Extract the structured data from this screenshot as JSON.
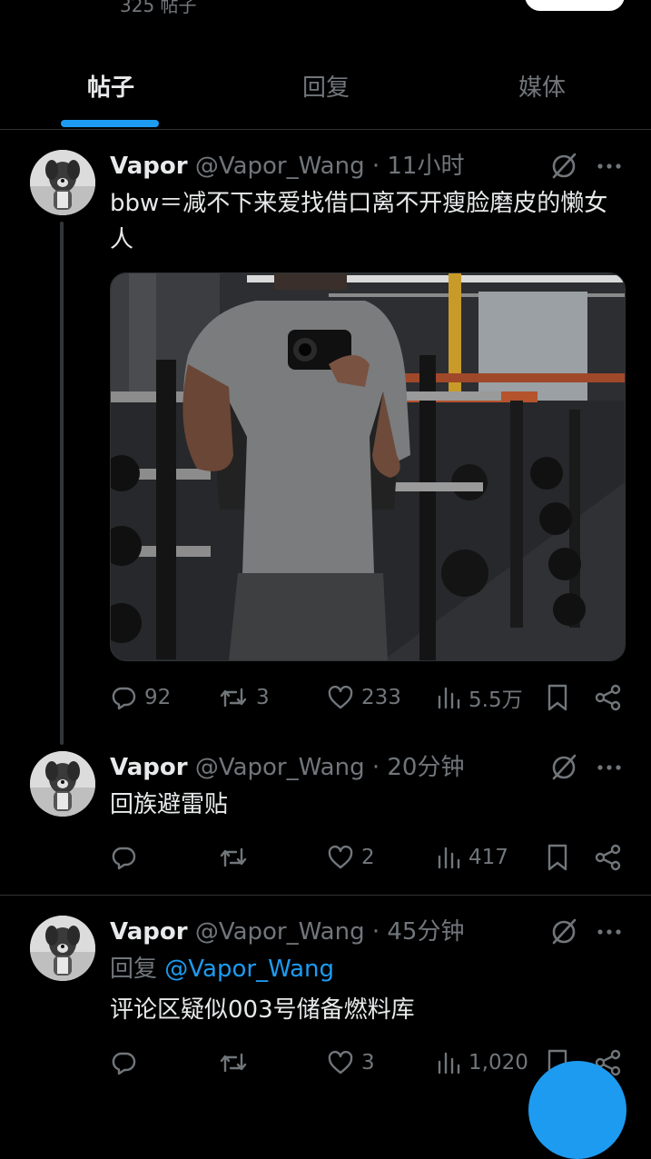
{
  "profile": {
    "post_count": "325 帖子"
  },
  "tabs": [
    {
      "label": "帖子",
      "active": true
    },
    {
      "label": "回复",
      "active": false
    },
    {
      "label": "媒体",
      "active": false
    }
  ],
  "colors": {
    "background": "#000000",
    "text_primary": "#e7e9ea",
    "text_secondary": "#71767b",
    "accent": "#1d9bf0",
    "divider": "#2f3336"
  },
  "icons": {
    "grok": "slashed-circle-icon",
    "more": "more-dots-icon",
    "reply": "reply-icon",
    "repost": "repost-icon",
    "like": "like-icon",
    "views": "views-icon",
    "bookmark": "bookmark-icon",
    "share": "share-icon"
  },
  "posts": [
    {
      "name": "Vapor",
      "handle": "@Vapor_Wang",
      "dot": "·",
      "time": "11小时",
      "text": "bbw＝减不下来爱找借口离不开瘦脸磨皮的懒女人",
      "has_media": true,
      "stats": {
        "replies": "92",
        "reposts": "3",
        "likes": "233",
        "views": "5.5万"
      }
    },
    {
      "name": "Vapor",
      "handle": "@Vapor_Wang",
      "dot": "·",
      "time": "20分钟",
      "text": "回族避雷贴",
      "stats": {
        "replies": "",
        "reposts": "",
        "likes": "2",
        "views": "417"
      }
    },
    {
      "name": "Vapor",
      "handle": "@Vapor_Wang",
      "dot": "·",
      "time": "45分钟",
      "reply_prefix": "回复",
      "reply_to": "@Vapor_Wang",
      "text": "评论区疑似003号储备燃料库",
      "stats": {
        "replies": "",
        "reposts": "",
        "likes": "3",
        "views": "1,020"
      }
    }
  ]
}
